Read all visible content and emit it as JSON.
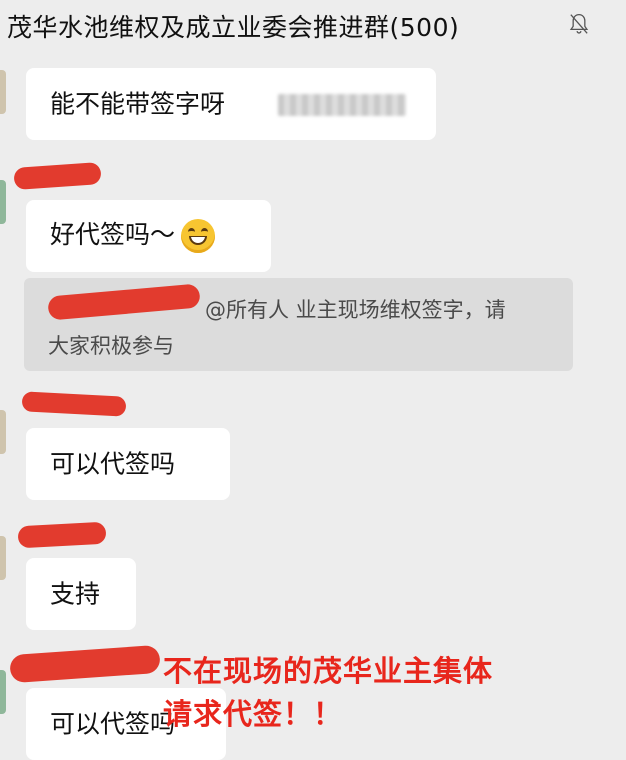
{
  "header": {
    "title": "茂华水池维权及成立业委会推进群(500)",
    "mute_icon": "bell-muted-icon"
  },
  "messages": [
    {
      "text": "能不能带签字呀"
    },
    {
      "text": "好代签吗～",
      "emoji": "grinning-face-icon"
    },
    {
      "quote": {
        "line1": "@所有人 业主现场维权签字，请",
        "line2": "大家积极参与"
      }
    },
    {
      "text": "可以代签吗"
    },
    {
      "text": "支持"
    },
    {
      "text": "可以代签吗"
    }
  ],
  "annotation": {
    "line1": "不在现场的茂华业主集体",
    "line2": "请求代签！！",
    "color": "#e8261c"
  },
  "colors": {
    "background": "#ededed",
    "bubble": "#ffffff",
    "quote": "#dcdcdc",
    "redaction": "#e23b2e"
  }
}
